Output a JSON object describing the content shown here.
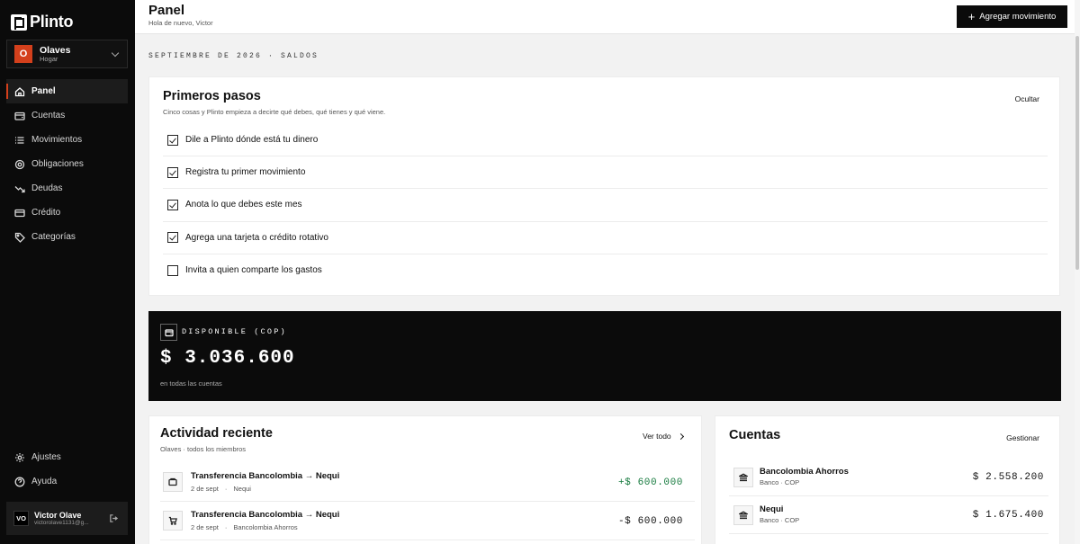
{
  "app": {
    "name": "Plinto"
  },
  "workspace": {
    "initial": "O",
    "name": "Olaves",
    "type": "Hogar"
  },
  "sidebar": {
    "items": [
      {
        "label": "Panel",
        "icon": "home-icon",
        "active": true
      },
      {
        "label": "Cuentas",
        "icon": "wallet-icon"
      },
      {
        "label": "Movimientos",
        "icon": "list-icon"
      },
      {
        "label": "Obligaciones",
        "icon": "target-icon"
      },
      {
        "label": "Deudas",
        "icon": "trend-down-icon"
      },
      {
        "label": "Crédito",
        "icon": "credit-card-icon"
      },
      {
        "label": "Categorías",
        "icon": "tag-icon"
      }
    ],
    "bottom": [
      {
        "label": "Ajustes",
        "icon": "gear-icon"
      },
      {
        "label": "Ayuda",
        "icon": "help-icon"
      }
    ]
  },
  "user": {
    "initials": "VO",
    "name": "Victor Olave",
    "email": "victorolave1131@g..."
  },
  "header": {
    "title": "Panel",
    "subtitle": "Hola de nuevo, Victor",
    "add_label": "Agregar movimiento"
  },
  "section_label": "septiembre de 2026 · saldos",
  "onboarding": {
    "title": "Primeros pasos",
    "subtitle": "Cinco cosas y Plinto empieza a decirte qué debes, qué tienes y qué viene.",
    "hide_label": "Ocultar",
    "items": [
      {
        "label": "Dile a Plinto dónde está tu dinero",
        "done": true
      },
      {
        "label": "Registra tu primer movimiento",
        "done": true
      },
      {
        "label": "Anota lo que debes este mes",
        "done": true
      },
      {
        "label": "Agrega una tarjeta o crédito rotativo",
        "done": true
      },
      {
        "label": "Invita a quien comparte los gastos",
        "done": false
      }
    ]
  },
  "balance": {
    "label": "DISPONIBLE (COP)",
    "amount": "$ 3.036.600",
    "note": "en todas las cuentas"
  },
  "activity": {
    "title": "Actividad reciente",
    "subtitle": "Olaves · todos los miembros",
    "link_label": "Ver todo",
    "rows": [
      {
        "name": "Transferencia Bancolombia → Nequi",
        "date": "2 de sept",
        "sep": "·",
        "account": "Nequi",
        "amount": "+$ 600.000",
        "icon": "wallet-icon",
        "positive": true
      },
      {
        "name": "Transferencia Bancolombia → Nequi",
        "date": "2 de sept",
        "sep": "·",
        "account": "Bancolombia Ahorros",
        "amount": "-$ 600.000",
        "icon": "cart-icon",
        "positive": false
      }
    ]
  },
  "accounts": {
    "title": "Cuentas",
    "link_label": "Gestionar",
    "rows": [
      {
        "name": "Bancolombia Ahorros",
        "meta": "Banco · COP",
        "amount": "$ 2.558.200",
        "icon": "bank-icon"
      },
      {
        "name": "Nequi",
        "meta": "Banco · COP",
        "amount": "$ 1.675.400",
        "icon": "bank-icon"
      }
    ]
  },
  "colors": {
    "accent": "#d4401c",
    "positive": "#167a3e",
    "dark": "#0b0b0b"
  }
}
